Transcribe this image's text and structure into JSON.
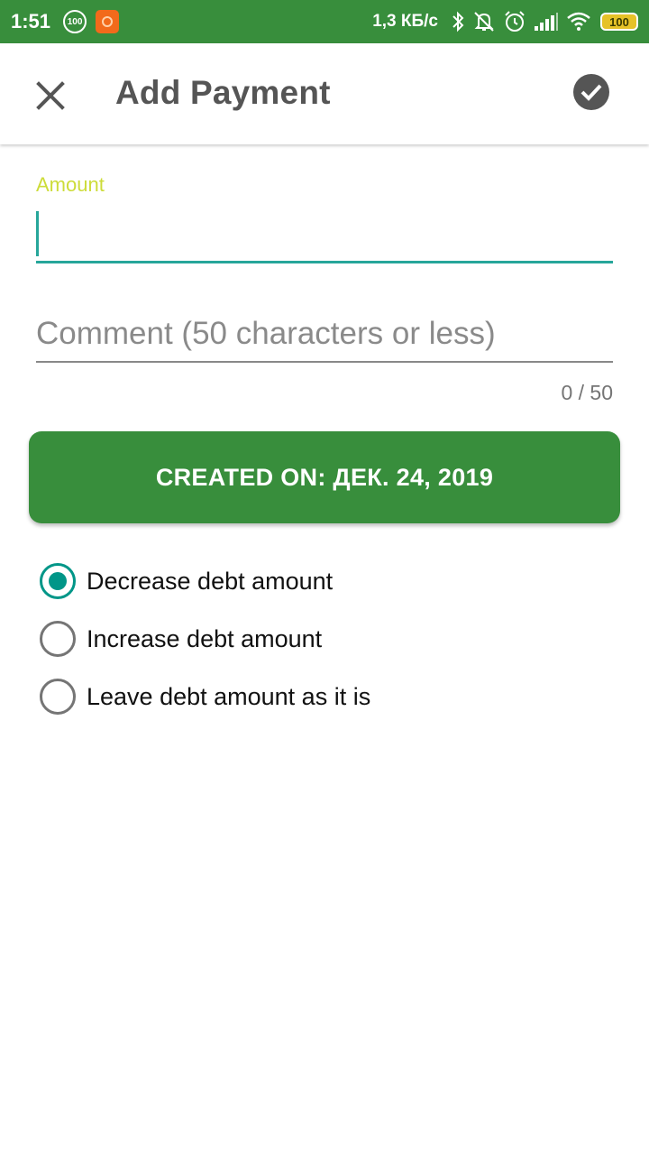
{
  "status_bar": {
    "time": "1:51",
    "badge": "100",
    "speed": "1,3 КБ/с",
    "battery": "100",
    "icons": [
      "bluetooth-icon",
      "notifications-off-icon",
      "alarm-icon",
      "signal-icon",
      "wifi-icon"
    ],
    "bg_color": "#388e3c"
  },
  "toolbar": {
    "title": "Add Payment",
    "close_icon": "close-icon",
    "confirm_icon": "check-circle-icon"
  },
  "form": {
    "amount_label": "Amount",
    "amount_value": "",
    "comment_placeholder": "Comment (50 characters or less)",
    "comment_value": "",
    "counter": "0 / 50",
    "created_button": "CREATED ON: ДЕК. 24, 2019"
  },
  "options": {
    "selected": 0,
    "items": [
      {
        "label": "Decrease debt amount"
      },
      {
        "label": "Increase debt amount"
      },
      {
        "label": "Leave debt amount as it is"
      }
    ]
  },
  "colors": {
    "primary": "#388e3c",
    "accent": "#009688",
    "label_accent": "#cddc39"
  }
}
